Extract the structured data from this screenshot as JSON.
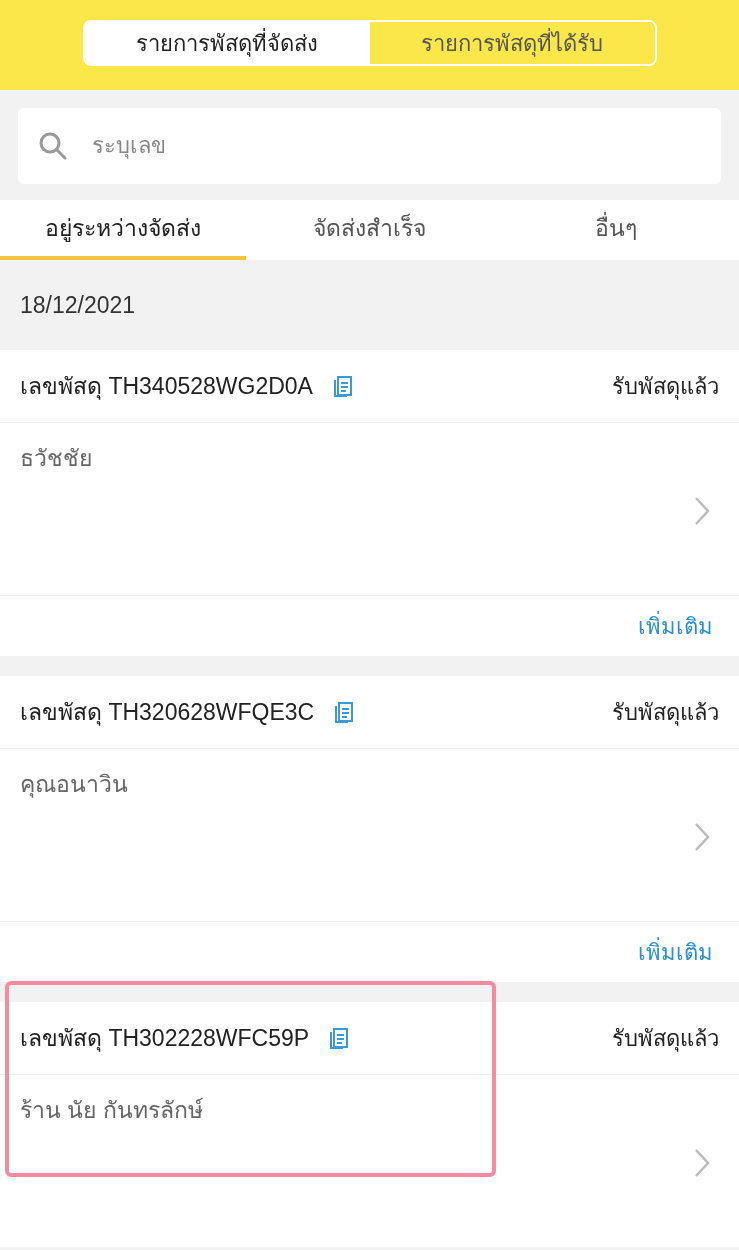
{
  "header_tabs": [
    {
      "label": "รายการพัสดุที่จัดส่ง",
      "selected": true
    },
    {
      "label": "รายการพัสดุที่ได้รับ",
      "selected": false
    }
  ],
  "search": {
    "placeholder": "ระบุเลข"
  },
  "tabs": [
    {
      "label": "อยู่ระหว่างจัดส่ง",
      "selected": true
    },
    {
      "label": "จัดส่งสำเร็จ",
      "selected": false
    },
    {
      "label": "อื่นๆ",
      "selected": false
    }
  ],
  "date": "18/12/2021",
  "parcels": [
    {
      "tracking": "เลขพัสดุ TH340528WG2D0A",
      "status": "รับพัสดุแล้ว",
      "recipient": "ธวัชชัย",
      "more": "เพิ่มเติม",
      "highlighted": false
    },
    {
      "tracking": "เลขพัสดุ TH320628WFQE3C",
      "status": "รับพัสดุแล้ว",
      "recipient": "คุณอนาวิน",
      "more": "เพิ่มเติม",
      "highlighted": false
    },
    {
      "tracking": "เลขพัสดุ TH302228WFC59P",
      "status": "รับพัสดุแล้ว",
      "recipient": "ร้าน นัย กันทรลักษ์",
      "highlighted": true
    }
  ]
}
